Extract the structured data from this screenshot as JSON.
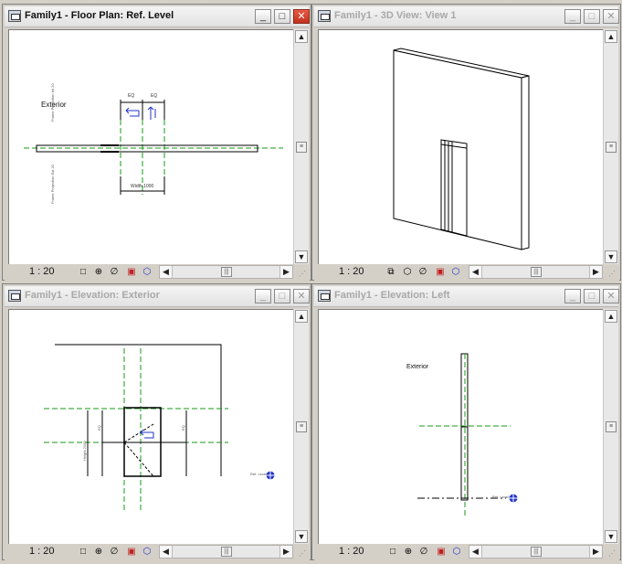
{
  "windows": [
    {
      "key": "floor_plan",
      "title": "Family1 - Floor Plan: Ref. Level",
      "state": "active",
      "scale": "1 : 20"
    },
    {
      "key": "view3d",
      "title": "Family1 - 3D View: View 1",
      "state": "inactive",
      "scale": "1 : 20"
    },
    {
      "key": "elev_exterior",
      "title": "Family1 - Elevation: Exterior",
      "state": "inactive",
      "scale": "1 : 20"
    },
    {
      "key": "elev_left",
      "title": "Family1 - Elevation: Left",
      "state": "inactive",
      "scale": "1 : 20"
    }
  ],
  "floor_plan": {
    "label_exterior": "Exterior",
    "dim_eq_left": "EQ",
    "dim_eq_right": "EQ",
    "dim_width": "Width 1000",
    "rotated_label_1": "Frame Projection Int 20",
    "rotated_label_2": "Frame Projection Ext 20"
  },
  "elev_exterior": {
    "rotated_height_label": "Height 2100",
    "small_dim_1": "EQ",
    "small_dim_2": "EQ",
    "marker_label": "Ref. Level"
  },
  "elev_left": {
    "label_exterior": "Exterior",
    "marker_label": "Ref. Level"
  },
  "colors": {
    "reference_plane": "#1a9a1a",
    "flip_arrow": "#2233cc",
    "close_active": "#d0402a"
  }
}
